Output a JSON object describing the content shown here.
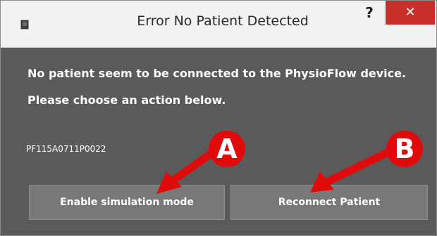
{
  "window": {
    "title": "Error No Patient Detected",
    "help_label": "?",
    "close_label": "✕"
  },
  "message": {
    "line1": "No patient seem to be connected to the PhysioFlow device.",
    "line2": "Please choose an action below."
  },
  "device": {
    "serial": "PF115A0711P0022"
  },
  "buttons": {
    "simulation_label": "Enable simulation mode",
    "reconnect_label": "Reconnect Patient"
  },
  "annotations": {
    "marker_a": "A",
    "marker_b": "B"
  },
  "colors": {
    "dialog_bg": "#5a5a5a",
    "button_bg": "#787878",
    "close_red": "#c9302c",
    "annotation_red": "#e10a0a"
  }
}
